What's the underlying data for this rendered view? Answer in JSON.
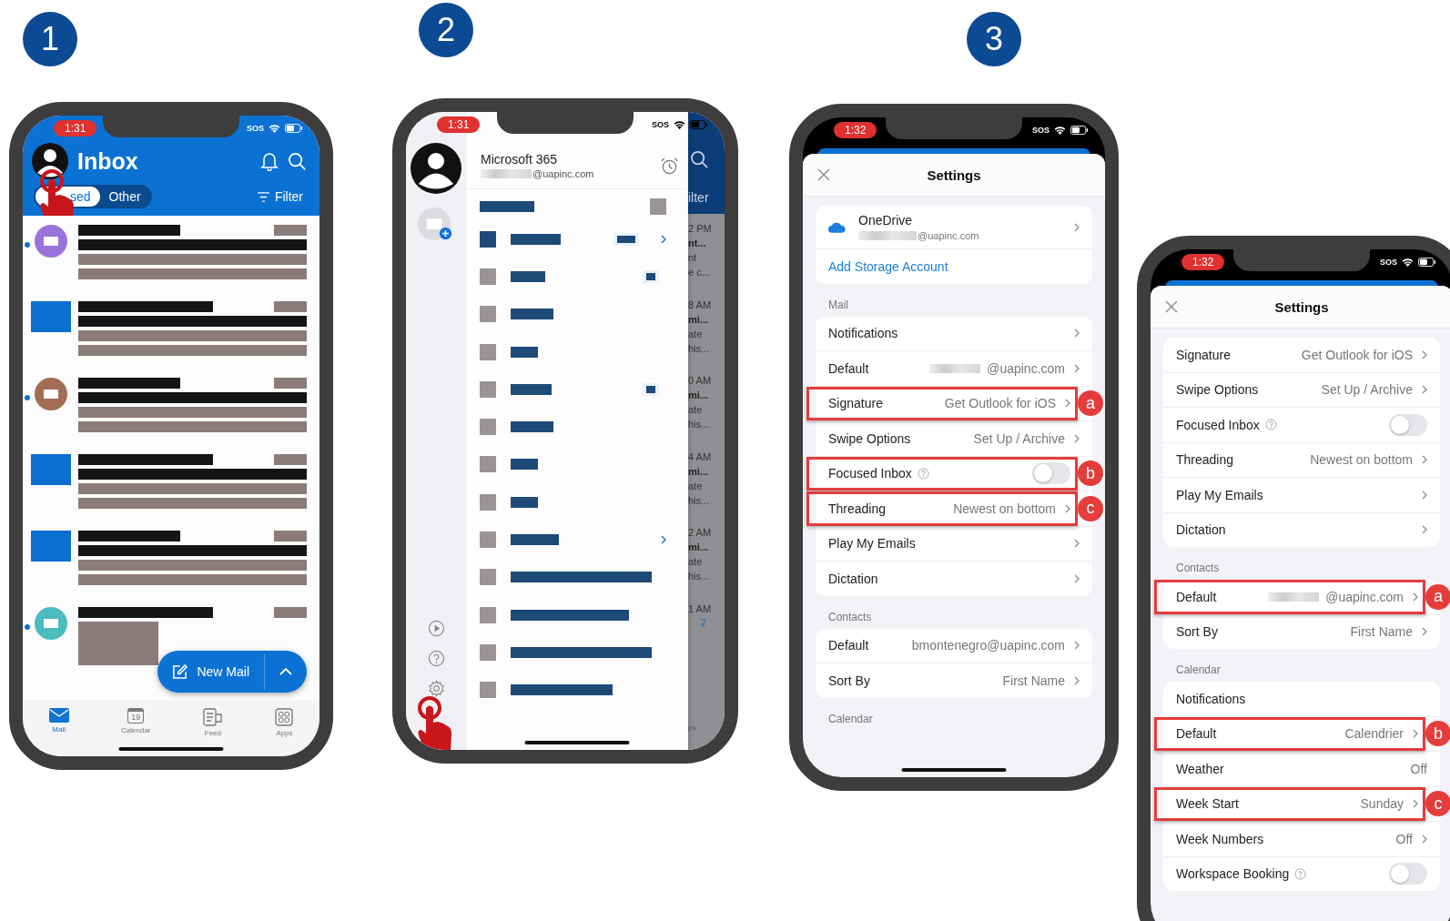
{
  "steps": [
    "1",
    "2",
    "3"
  ],
  "inbox": {
    "time": "1:31",
    "sos": "SOS",
    "title": "Inbox",
    "tabs": [
      {
        "label": "sed",
        "selected": true
      },
      {
        "label": "Other",
        "selected": false
      }
    ],
    "filter": "Filter",
    "messages": [
      {
        "kind": "circle",
        "color": "#9b72d9",
        "unread": true
      },
      {
        "kind": "square",
        "color": "#0b6fd0",
        "unread": false
      },
      {
        "kind": "circle",
        "color": "#a26c55",
        "unread": true
      },
      {
        "kind": "square",
        "color": "#0b6fd0",
        "unread": false
      },
      {
        "kind": "square",
        "color": "#0b6fd0",
        "unread": false
      },
      {
        "kind": "circle",
        "color": "#4cbcbf",
        "unread": true
      }
    ],
    "new_mail": "New Mail",
    "nav": [
      {
        "label": "Mail",
        "selected": true
      },
      {
        "label": "Calendar",
        "day": "19",
        "selected": false
      },
      {
        "label": "Feed",
        "selected": false
      },
      {
        "label": "Apps",
        "selected": false
      }
    ]
  },
  "drawer": {
    "time": "1:31",
    "sos": "SOS",
    "account": "Microsoft 365",
    "email": "@uapinc.com",
    "folders": [
      {
        "selected": true,
        "badge": true,
        "expandable": true
      },
      {
        "selected": false,
        "badge": true,
        "expandable": false
      },
      {
        "selected": false,
        "badge": false,
        "expandable": false
      },
      {
        "selected": false,
        "badge": false,
        "expandable": false
      },
      {
        "selected": false,
        "badge": true,
        "expandable": false
      },
      {
        "selected": false,
        "badge": false,
        "expandable": false
      },
      {
        "selected": false,
        "badge": false,
        "expandable": false
      },
      {
        "selected": false,
        "badge": false,
        "expandable": false
      },
      {
        "selected": false,
        "badge": false,
        "expandable": true
      },
      {
        "selected": false,
        "badge": false,
        "expandable": false
      },
      {
        "selected": false,
        "badge": false,
        "expandable": false
      },
      {
        "selected": false,
        "badge": false,
        "expandable": false
      },
      {
        "selected": false,
        "badge": false,
        "expandable": false
      }
    ],
    "behind": {
      "filter": "ilter",
      "rows": [
        {
          "time": "2 PM",
          "subject": "nt...",
          "lines": [
            "nt",
            "e c..."
          ]
        },
        {
          "time": "8 AM",
          "subject": "mi...",
          "lines": [
            "ate",
            "his..."
          ]
        },
        {
          "time": "0 AM",
          "subject": "mi...",
          "lines": [
            "ate",
            "his..."
          ]
        },
        {
          "time": "4 AM",
          "subject": "mi...",
          "lines": [
            "ate",
            "his..."
          ]
        },
        {
          "time": "2 AM",
          "subject": "mi...",
          "lines": [
            "ate",
            "his..."
          ]
        },
        {
          "time": "1 AM",
          "badge": "2"
        }
      ],
      "tab": "ps"
    }
  },
  "settings": [
    {
      "time": "1:32",
      "sos": "SOS",
      "title": "Settings",
      "sections": [
        {
          "rows": [
            {
              "kind": "account",
              "label": "OneDrive",
              "value": "@uapinc.com",
              "redacted": true
            },
            {
              "kind": "link",
              "label": "Add Storage Account"
            }
          ]
        },
        {
          "heading": "Mail",
          "rows": [
            {
              "kind": "nav",
              "label": "Notifications"
            },
            {
              "kind": "nav",
              "label": "Default",
              "value": "@uapinc.com",
              "redacted": true
            },
            {
              "kind": "nav",
              "label": "Signature",
              "value": "Get Outlook for iOS",
              "marker": "a"
            },
            {
              "kind": "nav",
              "label": "Swipe Options",
              "value": "Set Up / Archive"
            },
            {
              "kind": "toggle",
              "label": "Focused Inbox",
              "help": true,
              "on": false,
              "marker": "b"
            },
            {
              "kind": "nav",
              "label": "Threading",
              "value": "Newest on bottom",
              "marker": "c"
            },
            {
              "kind": "nav",
              "label": "Play My Emails"
            },
            {
              "kind": "nav",
              "label": "Dictation"
            }
          ]
        },
        {
          "heading": "Contacts",
          "rows": [
            {
              "kind": "nav",
              "label": "Default",
              "value": "bmontenegro@uapinc.com"
            },
            {
              "kind": "nav",
              "label": "Sort By",
              "value": "First Name"
            }
          ]
        },
        {
          "heading": "Calendar"
        }
      ]
    },
    {
      "time": "1:32",
      "sos": "SOS",
      "title": "Settings",
      "sections": [
        {
          "rows": [
            {
              "kind": "nav",
              "label": "Signature",
              "value": "Get Outlook for iOS"
            },
            {
              "kind": "nav",
              "label": "Swipe Options",
              "value": "Set Up / Archive"
            },
            {
              "kind": "toggle",
              "label": "Focused Inbox",
              "help": true,
              "on": false
            },
            {
              "kind": "nav",
              "label": "Threading",
              "value": "Newest on bottom"
            },
            {
              "kind": "nav",
              "label": "Play My Emails"
            },
            {
              "kind": "nav",
              "label": "Dictation"
            }
          ]
        },
        {
          "heading": "Contacts",
          "rows": [
            {
              "kind": "nav",
              "label": "Default",
              "value": "@uapinc.com",
              "redacted": true,
              "marker": "a"
            },
            {
              "kind": "nav",
              "label": "Sort By",
              "value": "First Name"
            }
          ]
        },
        {
          "heading": "Calendar",
          "rows": [
            {
              "kind": "plain",
              "label": "Notifications"
            },
            {
              "kind": "nav",
              "label": "Default",
              "value": "Calendrier",
              "marker": "b"
            },
            {
              "kind": "plain",
              "label": "Weather",
              "value": "Off"
            },
            {
              "kind": "nav",
              "label": "Week Start",
              "value": "Sunday",
              "marker": "c"
            },
            {
              "kind": "nav",
              "label": "Week Numbers",
              "value": "Off"
            },
            {
              "kind": "toggle",
              "label": "Workspace Booking",
              "help": true,
              "on": false
            }
          ]
        }
      ]
    }
  ]
}
